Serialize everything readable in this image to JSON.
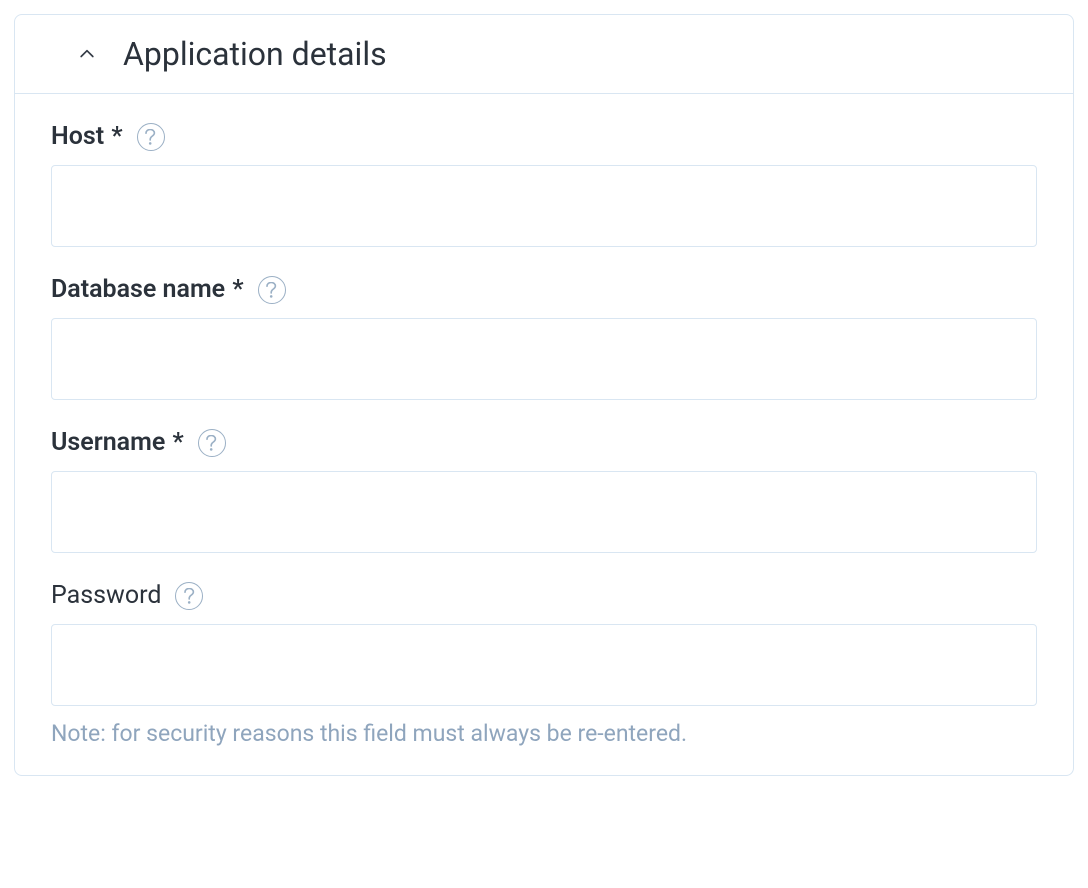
{
  "section": {
    "title": "Application details",
    "fields": {
      "host": {
        "label": "Host",
        "required_mark": " *",
        "value": ""
      },
      "database_name": {
        "label": "Database name",
        "required_mark": " *",
        "value": ""
      },
      "username": {
        "label": "Username",
        "required_mark": " *",
        "value": ""
      },
      "password": {
        "label": "Password",
        "value": "",
        "note": "Note: for security reasons this field must always be re-entered."
      }
    }
  }
}
